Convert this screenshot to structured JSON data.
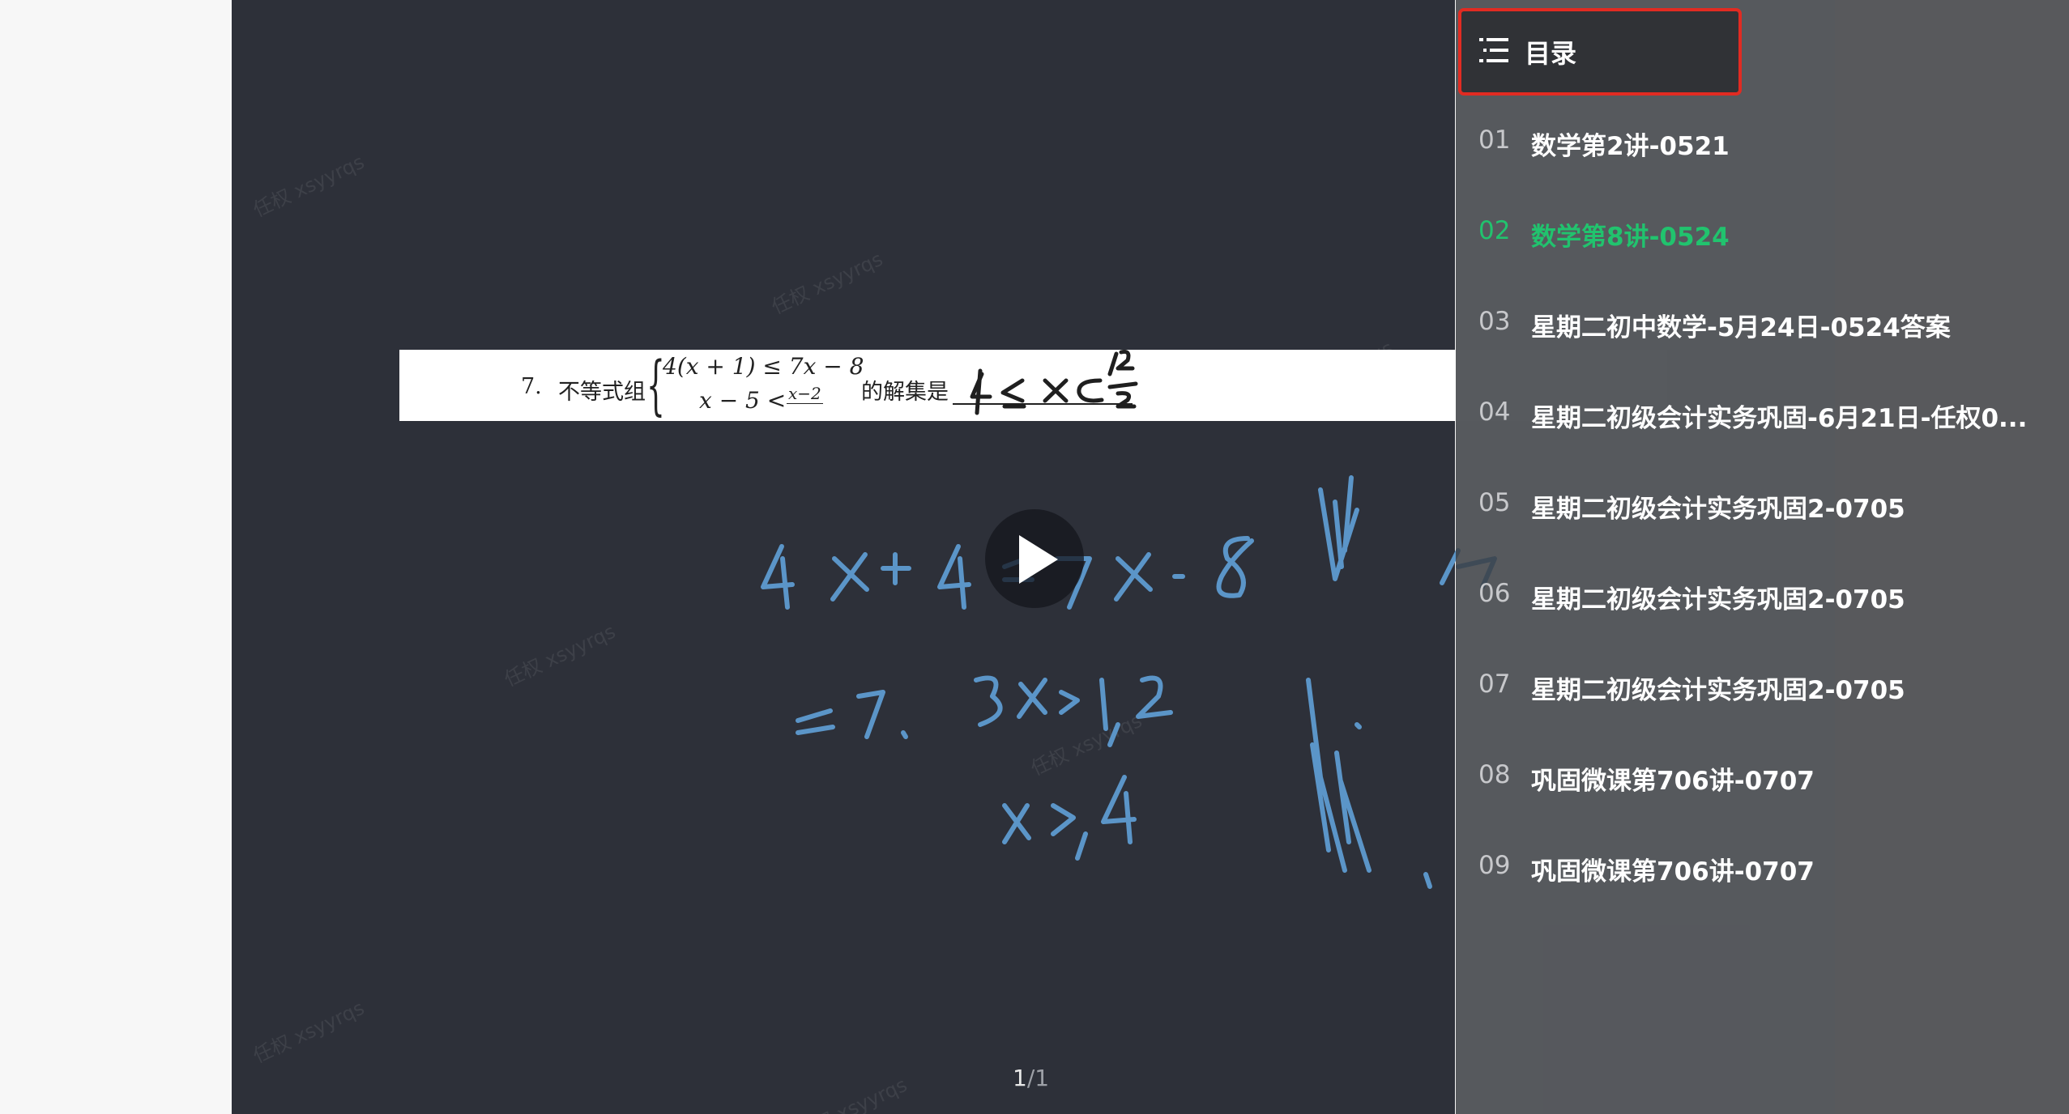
{
  "question": {
    "number": "7.",
    "prefix": "不等式组",
    "brace": "{",
    "eq1": "4(x + 1) ≤ 7x − 8",
    "eq2": "x − 5 <",
    "frac_num": "x−2",
    "suffix": "的解集是"
  },
  "watermark": "任权 xsyyrqs",
  "page_indicator": {
    "current": "1",
    "total": "1"
  },
  "toc": {
    "title": "目录",
    "items": [
      {
        "num": "01",
        "label": "数学第2讲-0521"
      },
      {
        "num": "02",
        "label": "数学第8讲-0524"
      },
      {
        "num": "03",
        "label": "星期二初中数学-5月24日-0524答案"
      },
      {
        "num": "04",
        "label": "星期二初级会计实务巩固-6月21日-任权0..."
      },
      {
        "num": "05",
        "label": "星期二初级会计实务巩固2-0705"
      },
      {
        "num": "06",
        "label": "星期二初级会计实务巩固2-0705"
      },
      {
        "num": "07",
        "label": "星期二初级会计实务巩固2-0705"
      },
      {
        "num": "08",
        "label": "巩固微课第706讲-0707"
      },
      {
        "num": "09",
        "label": "巩固微课第706讲-0707"
      }
    ],
    "active_index": 1
  },
  "colors": {
    "player_bg": "#2d3039",
    "ink_blue": "#5b95c8",
    "active_green": "#21c36e",
    "highlight_red": "#e12b22"
  },
  "icons": [
    "menu-list-icon",
    "play-icon"
  ]
}
